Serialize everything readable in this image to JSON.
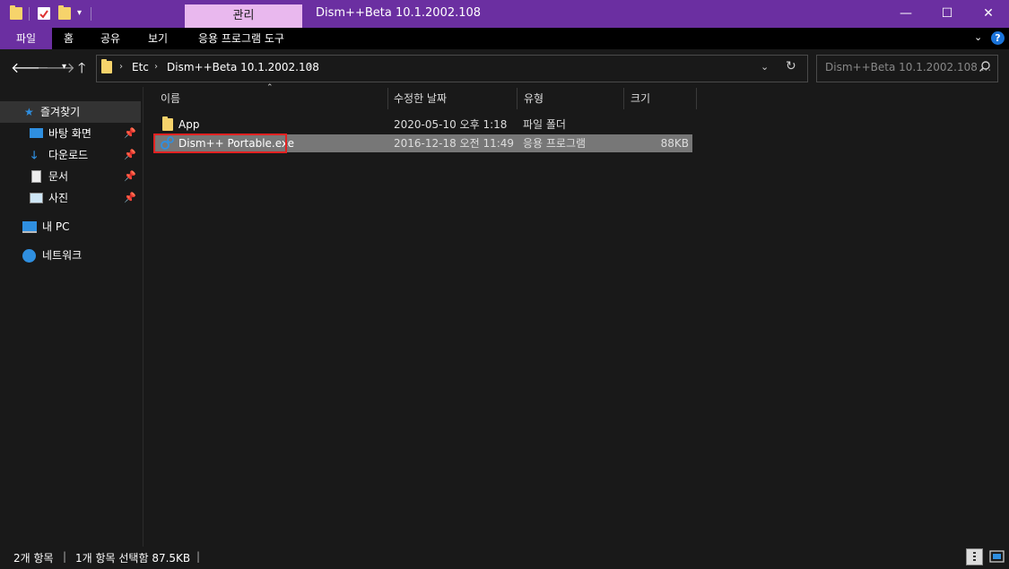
{
  "window": {
    "context_tab": "관리",
    "title": "Dism++Beta 10.1.2002.108",
    "min_icon": "—",
    "max_icon": "☐",
    "close_icon": "✕"
  },
  "ribbon": {
    "tabs": [
      "파일",
      "홈",
      "공유",
      "보기",
      "응용 프로그램 도구"
    ]
  },
  "address": {
    "crumbs": [
      "Etc",
      "Dism++Beta 10.1.2002.108"
    ],
    "search_placeholder": "Dism++Beta 10.1.2002.108 ..."
  },
  "nav": {
    "quick_access": "즐겨찾기",
    "items": [
      "바탕 화면",
      "다운로드",
      "문서",
      "사진"
    ],
    "this_pc": "내 PC",
    "network": "네트워크"
  },
  "columns": [
    "이름",
    "수정한 날짜",
    "유형",
    "크기"
  ],
  "files": [
    {
      "name": "App",
      "date": "2020-05-10 오후 1:18",
      "type": "파일 폴더",
      "size": ""
    },
    {
      "name": "Dism++ Portable.exe",
      "date": "2016-12-18 오전 11:49",
      "type": "응용 프로그램",
      "size": "88KB"
    }
  ],
  "status": {
    "count": "2개 항목",
    "selection": "1개 항목 선택함 87.5KB"
  },
  "colors": {
    "accent": "#6b2fa1",
    "context_tab": "#e9b8ee",
    "highlight_box": "#e32222",
    "selection": "#777777"
  }
}
